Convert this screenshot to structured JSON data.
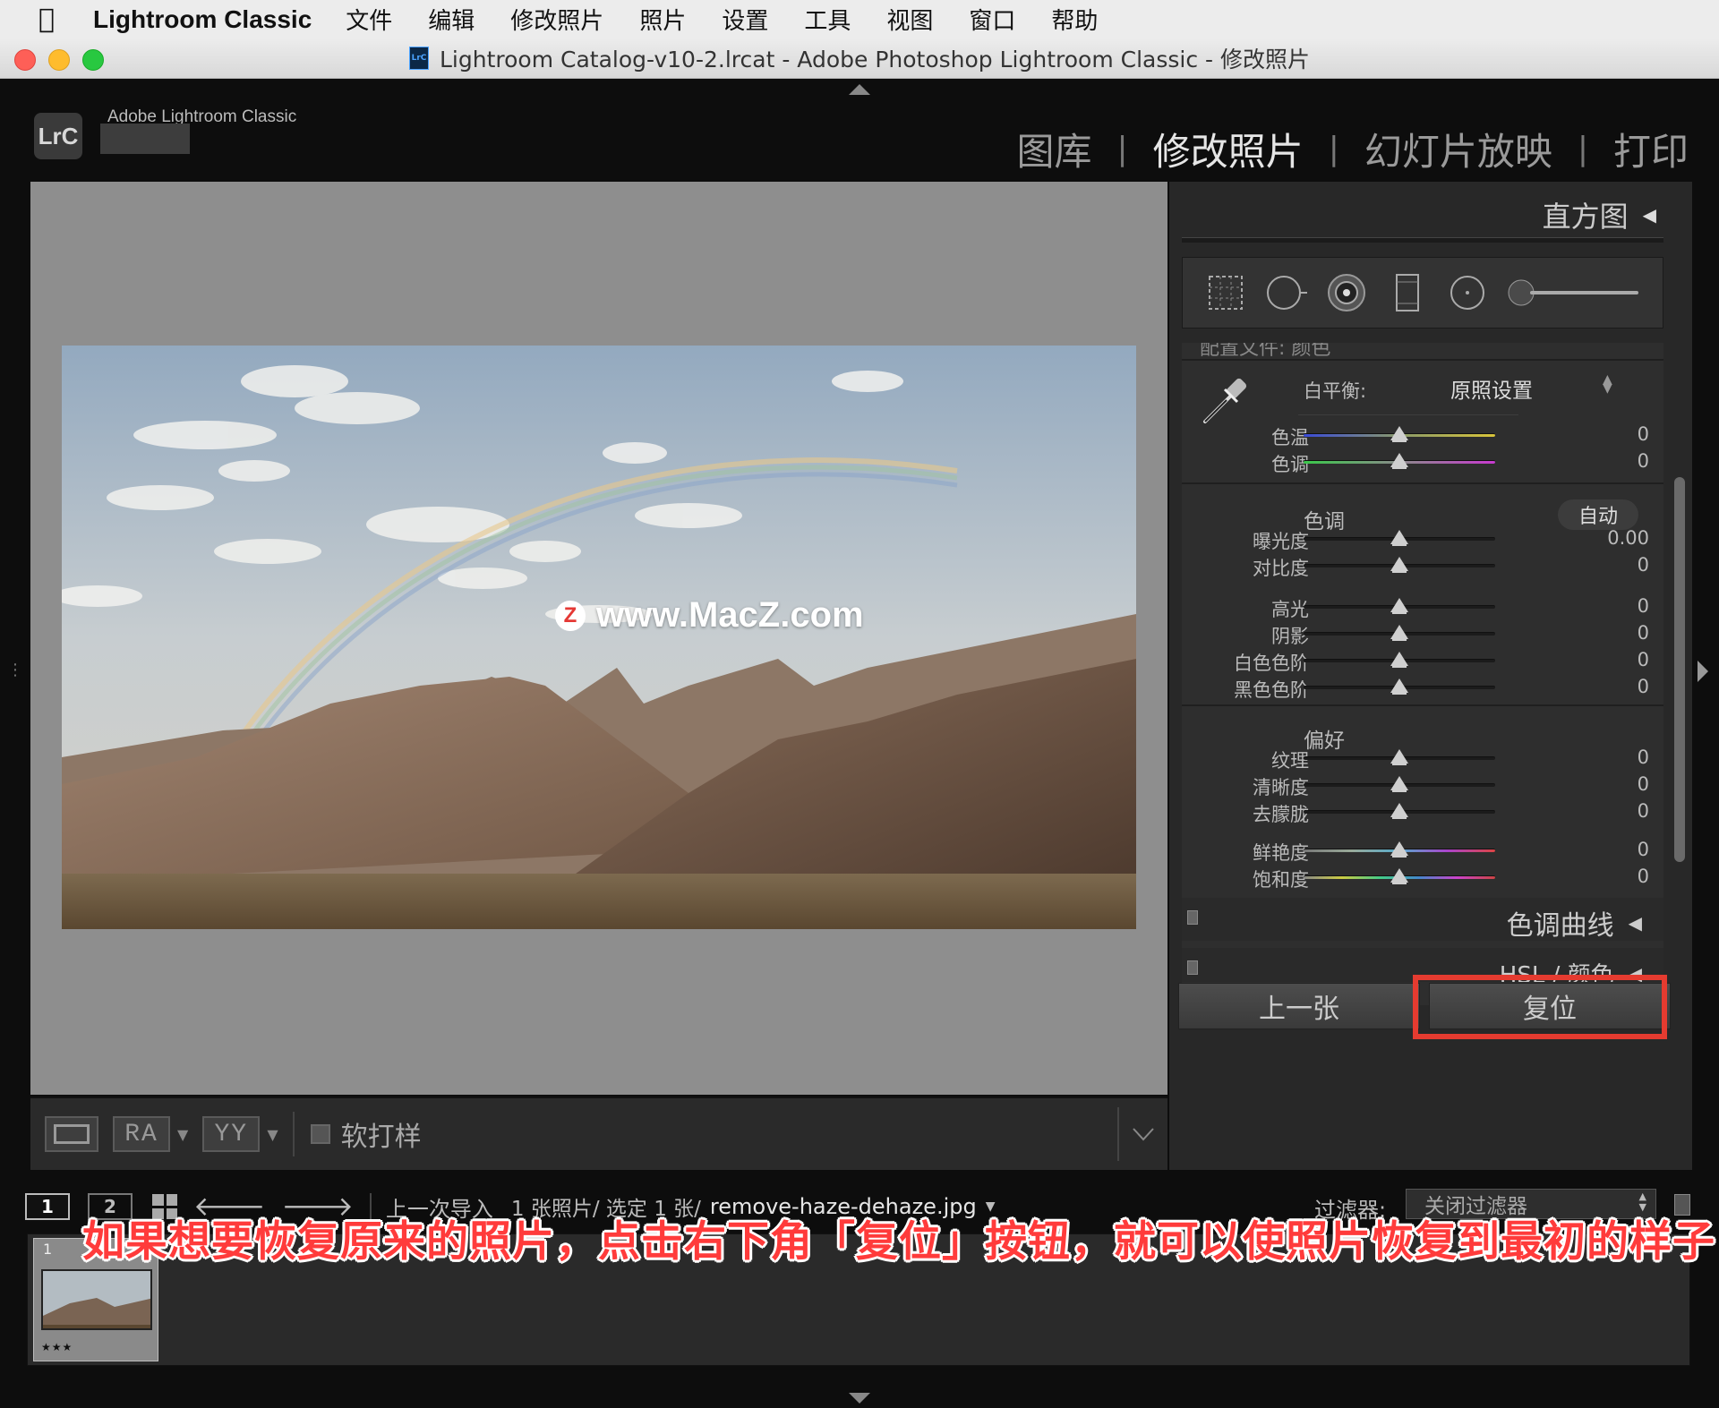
{
  "menubar": {
    "app_name": "Lightroom Classic",
    "items": [
      "文件",
      "编辑",
      "修改照片",
      "照片",
      "设置",
      "工具",
      "视图",
      "窗口",
      "帮助"
    ]
  },
  "window": {
    "title": "Lightroom Catalog-v10-2.lrcat - Adobe Photoshop Lightroom Classic - 修改照片",
    "doc_icon_text": "LrC"
  },
  "header": {
    "badge": "LrC",
    "brand": "Adobe Lightroom Classic",
    "modules": [
      {
        "label": "图库",
        "active": false
      },
      {
        "label": "修改照片",
        "active": true
      },
      {
        "label": "幻灯片放映",
        "active": false
      },
      {
        "label": "打印",
        "active": false
      }
    ]
  },
  "watermark": {
    "logo": "Z",
    "text": "www.MacZ.com"
  },
  "toolbar": {
    "ra_label": "RA",
    "yy_label": "YY",
    "soft_proof_label": "软打样"
  },
  "right_panel": {
    "histogram_label": "直方图",
    "cut_row": "配置文件:  颜色",
    "white_balance": {
      "label": "白平衡:",
      "value": "原照设置"
    },
    "wb_sliders": [
      {
        "label": "色温",
        "value": "0",
        "pos": 0.5
      },
      {
        "label": "色调",
        "value": "0",
        "pos": 0.5
      }
    ],
    "tone": {
      "title": "色调",
      "auto_label": "自动",
      "sliders": [
        {
          "label": "曝光度",
          "value": "0.00",
          "pos": 0.5
        },
        {
          "label": "对比度",
          "value": "0",
          "pos": 0.5
        },
        {
          "label": "高光",
          "value": "0",
          "pos": 0.5
        },
        {
          "label": "阴影",
          "value": "0",
          "pos": 0.5
        },
        {
          "label": "白色色阶",
          "value": "0",
          "pos": 0.5
        },
        {
          "label": "黑色色阶",
          "value": "0",
          "pos": 0.5
        }
      ]
    },
    "presence": {
      "title": "偏好",
      "sliders": [
        {
          "label": "纹理",
          "value": "0",
          "pos": 0.5
        },
        {
          "label": "清晰度",
          "value": "0",
          "pos": 0.5
        },
        {
          "label": "去朦胧",
          "value": "0",
          "pos": 0.5
        },
        {
          "label": "鲜艳度",
          "value": "0",
          "pos": 0.5
        },
        {
          "label": "饱和度",
          "value": "0",
          "pos": 0.5
        }
      ]
    },
    "tone_curve_label": "色调曲线",
    "hsl_label": "HSL / 颜色",
    "prev_button": "上一张",
    "reset_button": "复位"
  },
  "filmstrip_header": {
    "box1": "1",
    "box2": "2",
    "source": "上一次导入",
    "count": "1 张照片/ 选定 1 张/",
    "filename": "remove-haze-dehaze.jpg",
    "filter_label": "过滤器:",
    "filter_value": "关闭过滤器"
  },
  "filmstrip": {
    "thumb_number": "1",
    "stars": "★★★"
  },
  "caption": "如果想要恢复原来的照片，点击右下角「复位」按钮，就可以使照片恢复到最初的样子",
  "colors": {
    "highlight": "#e53b30",
    "caption": "#ff3b3b"
  }
}
